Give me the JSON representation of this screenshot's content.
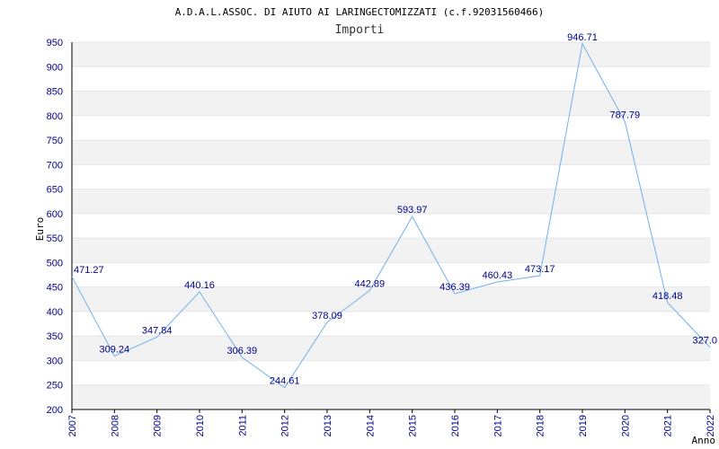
{
  "chart_data": {
    "type": "line",
    "title": "A.D.A.L.ASSOC. DI AIUTO AI LARINGECTOMIZZATI (c.f.92031560466)",
    "subtitle": "Importi",
    "xlabel": "Anno",
    "ylabel": "Euro",
    "categories": [
      "2007",
      "2008",
      "2009",
      "2010",
      "2011",
      "2012",
      "2013",
      "2014",
      "2015",
      "2016",
      "2017",
      "2018",
      "2019",
      "2020",
      "2021",
      "2022"
    ],
    "series": [
      {
        "values": [
          471.27,
          309.24,
          347.84,
          440.16,
          306.39,
          244.61,
          378.09,
          442.89,
          593.97,
          436.39,
          460.43,
          473.17,
          946.71,
          787.79,
          418.48,
          327.0
        ],
        "labels": [
          "471.27",
          "309.24",
          "347.84",
          "440.16",
          "306.39",
          "244.61",
          "378.09",
          "442.89",
          "593.97",
          "436.39",
          "460.43",
          "473.17",
          "946.71",
          "787.79",
          "418.48",
          "327.0"
        ]
      }
    ],
    "ylim": [
      200,
      950
    ],
    "yticks": [
      200,
      250,
      300,
      350,
      400,
      450,
      500,
      550,
      600,
      650,
      700,
      750,
      800,
      850,
      900,
      950
    ],
    "grid": true,
    "colors": {
      "line": "#6fb1ec",
      "band": "#f2f2f2",
      "tick_text": "#00008b",
      "axis": "#000000"
    }
  }
}
